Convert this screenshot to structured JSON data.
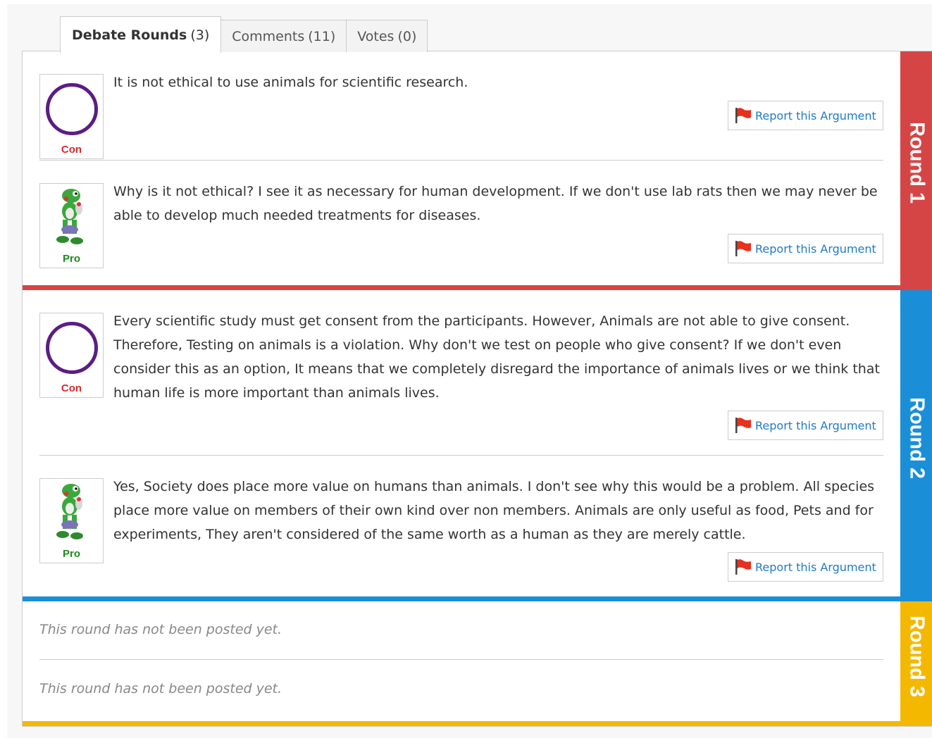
{
  "tabs": [
    {
      "label": "Debate Rounds",
      "count": "(3)"
    },
    {
      "label": "Comments",
      "count": "(11)"
    },
    {
      "label": "Votes",
      "count": "(0)"
    }
  ],
  "report_label": "Report this Argument",
  "rounds": [
    {
      "label": "Round 1",
      "color": "#d64545",
      "arguments": [
        {
          "side": "Con",
          "avatar": "purple-ring",
          "text": "It is not ethical to use animals for scientific research."
        },
        {
          "side": "Pro",
          "avatar": "yoshi-figure",
          "text": "Why is it not ethical? I see it as necessary for human development. If we don't use lab rats then we may never be able to develop much needed treatments for diseases."
        }
      ]
    },
    {
      "label": "Round 2",
      "color": "#1a8fd8",
      "arguments": [
        {
          "side": "Con",
          "avatar": "purple-ring",
          "text": "Every scientific study must get consent from the participants. However, Animals are not able to give consent. Therefore, Testing on animals is a violation. Why don't we test on people who give consent? If we don't even consider this as an option, It means that we completely disregard the importance of animals lives or we think that human life is more important than animals lives."
        },
        {
          "side": "Pro",
          "avatar": "yoshi-figure",
          "text": "Yes, Society does place more value on humans than animals. I don't see why this would be a problem. All species place more value on members of their own kind over non members. Animals are only useful as food, Pets and for experiments, They aren't considered of the same worth as a human as they are merely cattle."
        }
      ]
    },
    {
      "label": "Round 3",
      "color": "#f5b800",
      "empty": [
        "This round has not been posted yet.",
        "This round has not been posted yet."
      ]
    }
  ],
  "colors": {
    "con": "#d72b2b",
    "pro": "#1e8a1e",
    "link": "#1f7bc7",
    "avatar_ring": "#5b1d83",
    "flag": "#e8301e"
  }
}
